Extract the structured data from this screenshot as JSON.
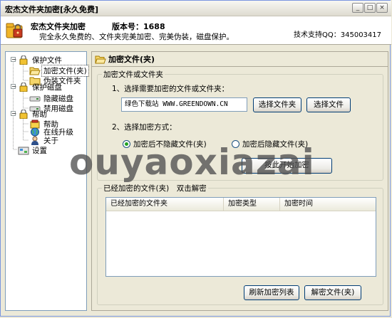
{
  "window": {
    "title": "宏杰文件夹加密[永久免费]",
    "minimize": "_",
    "maximize": "□",
    "close": "×"
  },
  "header": {
    "app_name": "宏杰文件夹加密",
    "version": "版本号：1688",
    "slogan": "完全永久免费的、文件夹完美加密、完美伪装，磁盘保护。",
    "support": "技术支持QQ：345003417"
  },
  "sidebar": {
    "protect_files": "保护文件",
    "encrypt_folder": "加密文件(夹)",
    "disguise_folder": "伪装文件夹",
    "protect_disk": "保护磁盘",
    "hide_disk": "隐藏磁盘",
    "disable_disk": "禁用磁盘",
    "help_group": "帮助",
    "help": "帮助",
    "online_update": "在线升级",
    "about": "关于",
    "settings": "设置"
  },
  "panel": {
    "title": "加密文件(夹)",
    "group_title": "加密文件或文件夹",
    "step1": "1、选择需要加密的文件或文件夹：",
    "path_value": "绿色下载站 WWW.GREENDOWN.CN",
    "choose_folder": "选择文件夹",
    "choose_file": "选择文件",
    "step2": "2、选择加密方式：",
    "option_no_hide": "加密后不隐藏文件(夹)",
    "option_hide": "加密后隐藏文件(夹)",
    "start_encrypt": "按此开始加密"
  },
  "encrypted": {
    "group_title": "已经加密的文件(夹)　双击解密",
    "columns": [
      "已经加密的文件夹",
      "加密类型",
      "加密时间"
    ],
    "refresh": "刷新加密列表",
    "decrypt": "解密文件(夹)"
  },
  "watermark": "ouyaoxiazai",
  "colors": {
    "window_bg": "#ece9d8",
    "folder_yellow": "#f5d66b",
    "radio_dot": "#21a121"
  }
}
